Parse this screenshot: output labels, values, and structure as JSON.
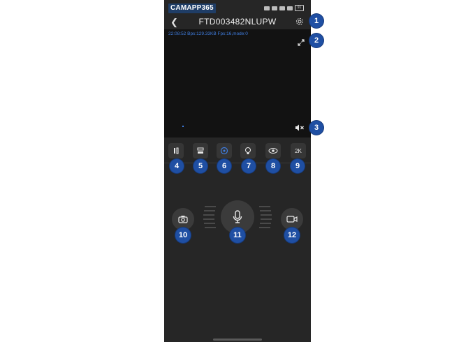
{
  "status_bar": {
    "brand": "CAMAPP365",
    "battery": "91"
  },
  "header": {
    "title": "FTD003482NLUPW",
    "back_icon": "chevron-left-icon",
    "settings_icon": "gear-icon"
  },
  "video": {
    "osd_text": "22:08:52  Bps:129.33KB  Fps:16,mode:0",
    "fullscreen_icon": "expand-icon",
    "mute_icon": "speaker-muted-icon"
  },
  "toolbar": {
    "buttons": [
      {
        "icon": "pan-icon"
      },
      {
        "icon": "tilt-icon"
      },
      {
        "icon": "cruise-icon"
      },
      {
        "icon": "light-bulb-icon"
      },
      {
        "icon": "detect-icon"
      },
      {
        "label": "2K"
      }
    ]
  },
  "controls": {
    "snapshot_icon": "camera-icon",
    "talk_icon": "microphone-icon",
    "record_icon": "video-record-icon"
  },
  "callouts": [
    "1",
    "2",
    "3",
    "4",
    "5",
    "6",
    "7",
    "8",
    "9",
    "10",
    "11",
    "12"
  ],
  "colors": {
    "badge": "#1f4fa3",
    "panel": "#262626",
    "osd": "#3f7de0"
  }
}
